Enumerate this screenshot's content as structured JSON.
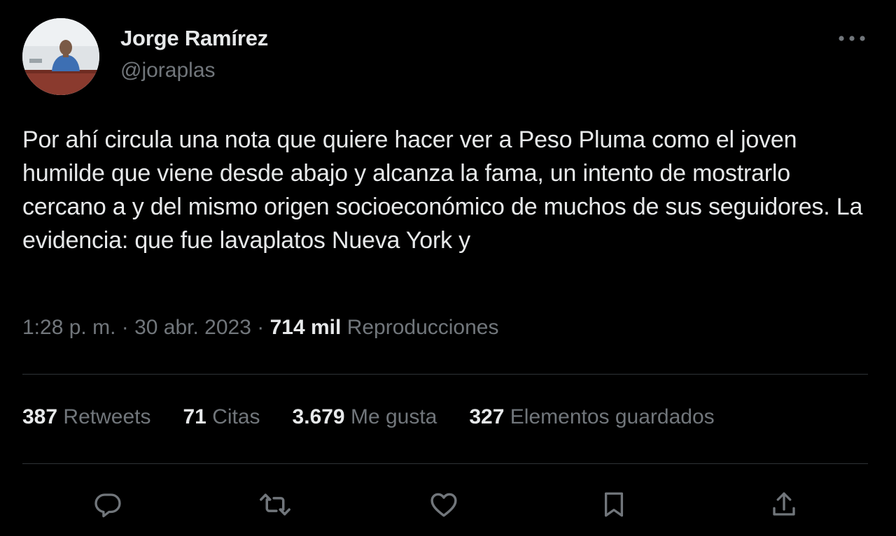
{
  "user": {
    "display_name": "Jorge Ramírez",
    "handle": "@joraplas"
  },
  "tweet": {
    "text": "Por ahí circula una nota que quiere hacer ver a Peso Pluma como el joven humilde que viene desde abajo y alcanza la fama, un intento de mostrarlo cercano a y del mismo origen socioeconómico de muchos de sus seguidores. La evidencia: que fue lavaplatos Nueva York y"
  },
  "meta": {
    "time": "1:28 p. m.",
    "separator": "·",
    "date": "30 abr. 2023",
    "views_count": "714 mil",
    "views_label": "Reproducciones"
  },
  "stats": {
    "retweets_count": "387",
    "retweets_label": "Retweets",
    "quotes_count": "71",
    "quotes_label": "Citas",
    "likes_count": "3.679",
    "likes_label": "Me gusta",
    "bookmarks_count": "327",
    "bookmarks_label": "Elementos guardados"
  },
  "icons": {
    "more": "more-horizontal-icon",
    "reply": "reply-icon",
    "retweet": "retweet-icon",
    "like": "heart-icon",
    "bookmark": "bookmark-icon",
    "share": "share-icon"
  },
  "colors": {
    "background": "#000000",
    "primary_text": "#e7e9ea",
    "secondary_text": "#71767b",
    "divider": "#2f3336"
  }
}
